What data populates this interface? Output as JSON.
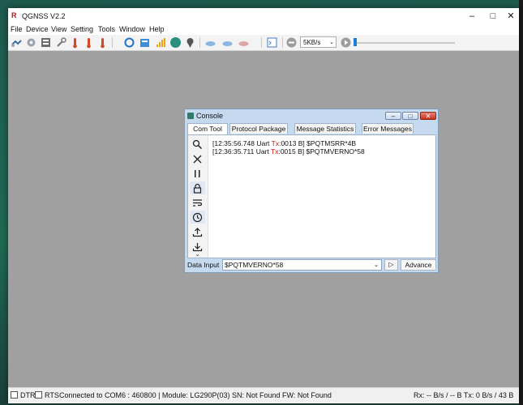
{
  "window": {
    "title": "QGNSS V2.2",
    "controls": [
      "minimize",
      "maximize",
      "close"
    ]
  },
  "menu": [
    "File",
    "Device",
    "View",
    "Setting",
    "Tools",
    "Window",
    "Help"
  ],
  "toolbar": {
    "icons": [
      "connect-icon",
      "settings-gear-icon",
      "device-info-icon",
      "wrench-icon",
      "temperature-h-icon",
      "temperature-w-icon",
      "temperature-icon",
      "refresh-icon",
      "database-icon",
      "signal-bars-icon",
      "satellite-globe-icon",
      "map-pin-icon",
      "cloud-icon",
      "cloud-upload-icon",
      "cloud-download-icon",
      "console-icon",
      "record-icon",
      "play-icon"
    ],
    "speed": "5KB/s"
  },
  "console": {
    "title": "Console",
    "tabs": [
      "Com Tool",
      "Protocol Package",
      "Message Statistics",
      "Error Messages"
    ],
    "active_tab": "Com Tool",
    "side_icons": [
      "search-icon",
      "clear-icon",
      "pause-icon",
      "lock-icon",
      "wrap-icon",
      "clock-icon",
      "upload-icon",
      "download-icon",
      "more-icon"
    ],
    "log": [
      {
        "prefix": "[12:35:56.748 Uart ",
        "dir": "Tx",
        "suffix": ":0013 B] $PQTMSRR*4B"
      },
      {
        "prefix": "[12:36:35.711 Uart ",
        "dir": "Tx",
        "suffix": ":0015 B] $PQTMVERNO*58"
      }
    ],
    "data_input_label": "Data Input",
    "data_input_value": "$PQTMVERNO*58",
    "send_label": "▷",
    "advance_label": "Advance"
  },
  "statusbar": {
    "dtr": "DTR",
    "rts": "RTS",
    "connection": "Connected to COM6 : 460800 | Module: LG290P(03) SN: Not Found FW: Not Found",
    "rates": "Rx: -- B/s / -- B Tx: 0 B/s / 43 B"
  }
}
